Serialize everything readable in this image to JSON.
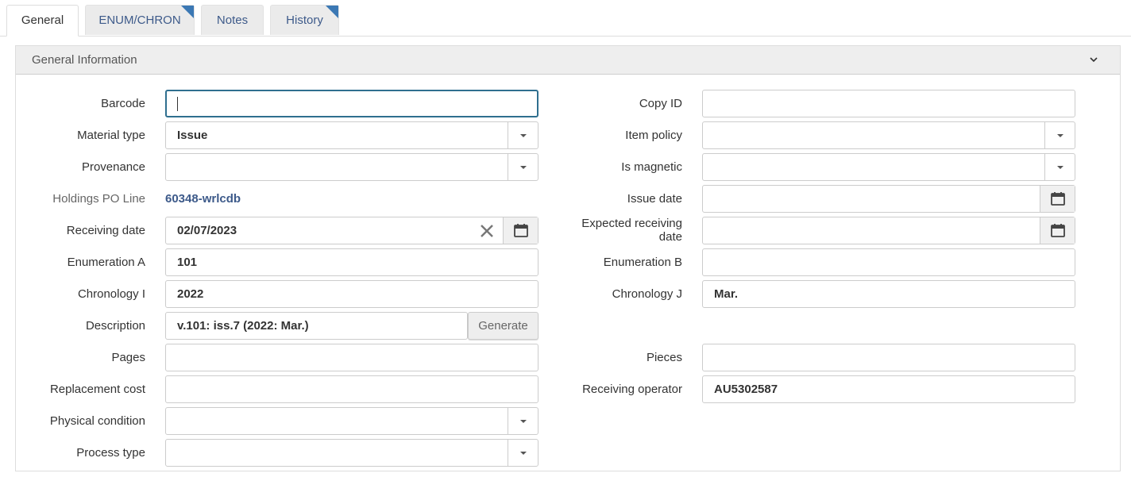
{
  "tabs": [
    {
      "label": "General",
      "active": true,
      "has_indicator": false
    },
    {
      "label": "ENUM/CHRON",
      "active": false,
      "has_indicator": true
    },
    {
      "label": "Notes",
      "active": false,
      "has_indicator": false
    },
    {
      "label": "History",
      "active": false,
      "has_indicator": true
    }
  ],
  "section": {
    "title": "General Information",
    "toggle_icon": "chevron-down-icon"
  },
  "left": {
    "barcode": {
      "label": "Barcode",
      "value": ""
    },
    "material_type": {
      "label": "Material type",
      "value": "Issue"
    },
    "provenance": {
      "label": "Provenance",
      "value": ""
    },
    "holdings_po_line": {
      "label": "Holdings PO Line",
      "value": "60348-wrlcdb"
    },
    "receiving_date": {
      "label": "Receiving date",
      "value": "02/07/2023"
    },
    "enumeration_a": {
      "label": "Enumeration A",
      "value": "101"
    },
    "chronology_i": {
      "label": "Chronology I",
      "value": "2022"
    },
    "description": {
      "label": "Description",
      "value": "v.101: iss.7 (2022: Mar.)",
      "button": "Generate"
    },
    "pages": {
      "label": "Pages",
      "value": ""
    },
    "replacement_cost": {
      "label": "Replacement cost",
      "value": ""
    },
    "physical_condition": {
      "label": "Physical condition",
      "value": ""
    },
    "process_type": {
      "label": "Process type",
      "value": ""
    }
  },
  "right": {
    "copy_id": {
      "label": "Copy ID",
      "value": ""
    },
    "item_policy": {
      "label": "Item policy",
      "value": ""
    },
    "is_magnetic": {
      "label": "Is magnetic",
      "value": ""
    },
    "issue_date": {
      "label": "Issue date",
      "value": ""
    },
    "expected_receiving_date": {
      "label_line1": "Expected receiving",
      "label_line2": "date",
      "value": ""
    },
    "enumeration_b": {
      "label": "Enumeration B",
      "value": ""
    },
    "chronology_j": {
      "label": "Chronology J",
      "value": "Mar."
    },
    "pieces": {
      "label": "Pieces",
      "value": ""
    },
    "receiving_operator": {
      "label": "Receiving operator",
      "value": "AU5302587"
    }
  },
  "colors": {
    "link": "#3d5a8a",
    "tab_indicator": "#3b78b4",
    "focus_border": "#2f6f8f"
  }
}
